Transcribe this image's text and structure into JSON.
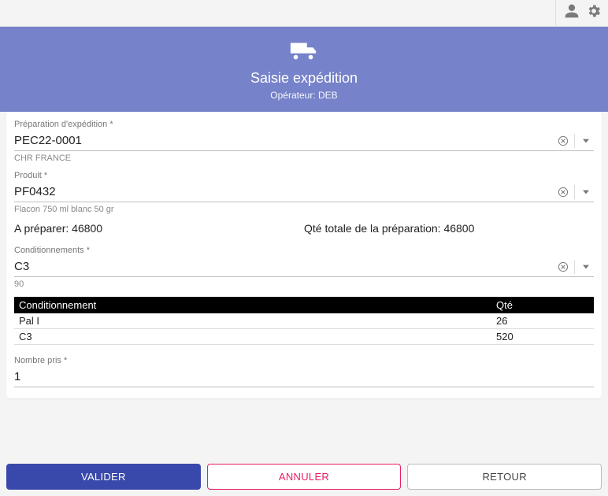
{
  "header": {
    "title": "Saisie expédition",
    "operator_label": "Opérateur:",
    "operator_value": "DEB"
  },
  "fields": {
    "preparation": {
      "label": "Préparation d'expédition *",
      "value": "PEC22-0001",
      "hint": "CHR FRANCE"
    },
    "product": {
      "label": "Produit *",
      "value": "PF0432",
      "hint": "Flacon 750 ml blanc 50 gr"
    },
    "conditionnements": {
      "label": "Conditionnements *",
      "value": "C3",
      "hint": "90"
    },
    "nombre_pris": {
      "label": "Nombre pris *",
      "value": "1"
    }
  },
  "summary": {
    "to_prepare_label": "A préparer:",
    "to_prepare_value": "46800",
    "total_label": "Qté totale de la préparation:",
    "total_value": "46800"
  },
  "table": {
    "columns": [
      "Conditionnement",
      "Qté"
    ],
    "rows": [
      {
        "c0": "Pal I",
        "c1": "26"
      },
      {
        "c0": "C3",
        "c1": "520"
      }
    ]
  },
  "buttons": {
    "validate": "VALIDER",
    "cancel": "ANNULER",
    "back": "RETOUR"
  }
}
